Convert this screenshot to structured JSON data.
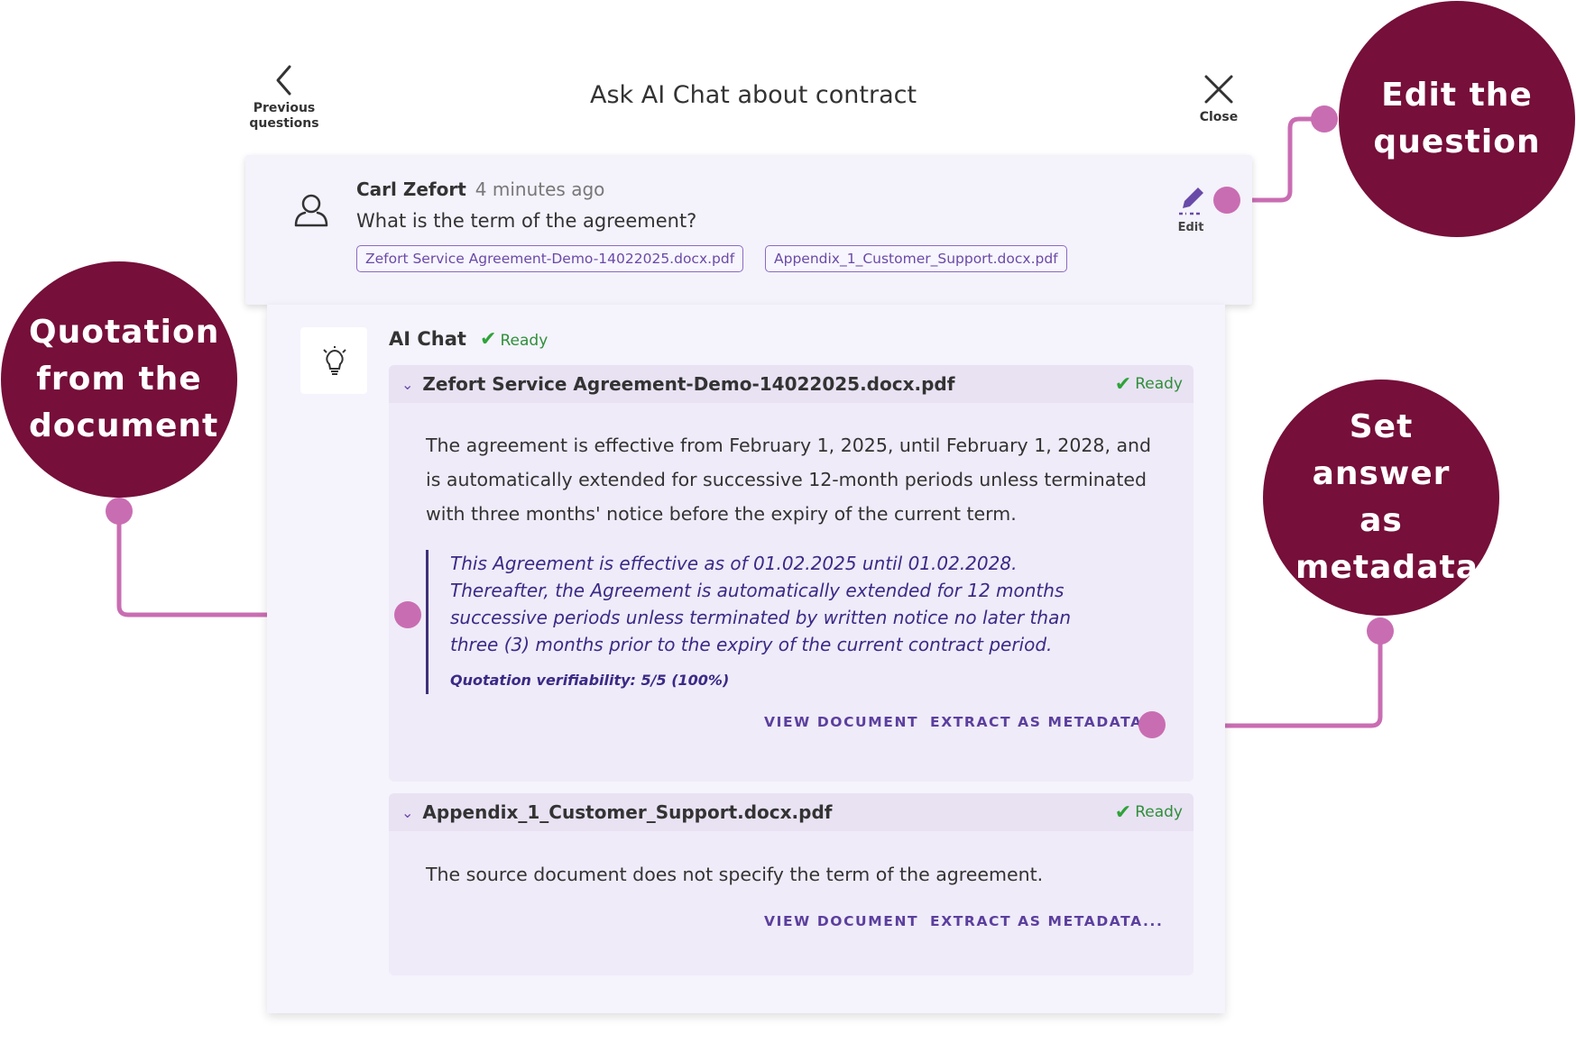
{
  "header": {
    "back_label_line1": "Previous",
    "back_label_line2": "questions",
    "title": "Ask AI Chat about contract",
    "close_label": "Close"
  },
  "question": {
    "author": "Carl Zefort",
    "time": "4 minutes ago",
    "text": "What is the term of the agreement?",
    "attachments": [
      "Zefort Service Agreement-Demo-14022025.docx.pdf",
      "Appendix_1_Customer_Support.docx.pdf"
    ],
    "edit_label": "Edit"
  },
  "ai": {
    "name": "AI Chat",
    "status": "Ready"
  },
  "sections": [
    {
      "title": "Zefort Service Agreement-Demo-14022025.docx.pdf",
      "status": "Ready",
      "answer": "The agreement is effective from February 1, 2025, until February 1, 2028, and is automatically extended for successive 12-month periods unless terminated with three months' notice before the expiry of the current term.",
      "quote": "This Agreement is effective as of 01.02.2025 until 01.02.2028. Thereafter, the Agreement is automatically extended for 12 months successive periods unless terminated by written notice no later than three (3) months prior to the expiry of the current contract period.",
      "verifiability": "Quotation verifiability: 5/5 (100%)",
      "view_label": "VIEW DOCUMENT",
      "extract_label": "EXTRACT AS METADATA..."
    },
    {
      "title": "Appendix_1_Customer_Support.docx.pdf",
      "status": "Ready",
      "answer": "The source document does not specify the term of the agreement.",
      "view_label": "VIEW DOCUMENT",
      "extract_label": "EXTRACT AS METADATA..."
    }
  ],
  "annotations": {
    "edit_question": "Edit the question",
    "quotation": "Quotation from the document",
    "metadata": "Set answer as metadata"
  },
  "colors": {
    "accent": "#6a4aa8",
    "callout": "#760f3a",
    "connector": "#c96db2",
    "ready": "#2fa33a"
  },
  "icons": {
    "back": "chevron-left-icon",
    "close": "close-icon",
    "user": "user-icon",
    "edit": "pencil-icon",
    "ai": "lightbulb-icon",
    "status": "check-icon",
    "expand": "chevron-down-icon"
  }
}
